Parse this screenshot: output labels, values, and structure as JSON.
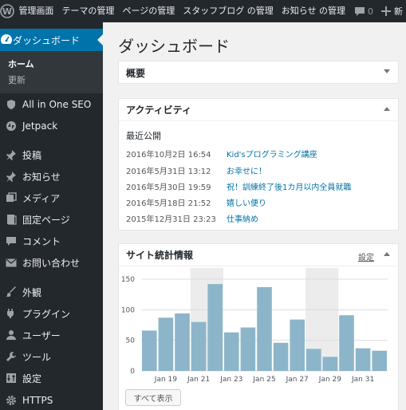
{
  "adminbar": {
    "items": [
      "管理画面",
      "テーマの管理",
      "ページの管理",
      "スタッフブログ の管理",
      "お知らせ の管理"
    ],
    "comment_count": "0",
    "new_label": "新"
  },
  "sidebar": {
    "dashboard_label": "ダッシュボード",
    "submenu": [
      "ホーム",
      "更新"
    ],
    "items": [
      {
        "label": "All in One SEO",
        "icon": "shield-icon"
      },
      {
        "label": "Jetpack",
        "icon": "jetpack-icon"
      },
      {
        "label": "投稿",
        "icon": "pin-icon"
      },
      {
        "label": "お知らせ",
        "icon": "pin-icon"
      },
      {
        "label": "メディア",
        "icon": "media-icon"
      },
      {
        "label": "固定ページ",
        "icon": "page-icon"
      },
      {
        "label": "コメント",
        "icon": "comment-icon"
      },
      {
        "label": "お問い合わせ",
        "icon": "mail-icon"
      },
      {
        "label": "外観",
        "icon": "brush-icon"
      },
      {
        "label": "プラグイン",
        "icon": "plugin-icon"
      },
      {
        "label": "ユーザー",
        "icon": "user-icon"
      },
      {
        "label": "ツール",
        "icon": "wrench-icon"
      },
      {
        "label": "設定",
        "icon": "settings-icon"
      },
      {
        "label": "HTTPS",
        "icon": "gear-icon"
      }
    ]
  },
  "main": {
    "title": "ダッシュボード",
    "overview": {
      "title": "概要"
    },
    "activity": {
      "title": "アクティビティ",
      "subtitle": "最近公開",
      "rows": [
        {
          "date": "2016年10月2日 16:54",
          "title": "Kid'sプログラミング講座"
        },
        {
          "date": "2016年5月31日 13:12",
          "title": "お幸せに！"
        },
        {
          "date": "2016年5月30日 19:59",
          "title": "祝！訓練終了後1カ月以内全員就職"
        },
        {
          "date": "2016年5月18日 21:52",
          "title": "嬉しい便り"
        },
        {
          "date": "2015年12月31日 23:23",
          "title": "仕事納め"
        }
      ]
    },
    "stats": {
      "title": "サイト統計情報",
      "config_label": "設定",
      "show_all_label": "すべて表示"
    }
  },
  "colors": {
    "accent": "#0073aa",
    "bar": "#8cb5c9",
    "weekend_band": "#ececec"
  },
  "chart_data": {
    "type": "bar",
    "categories": [
      "Jan 18",
      "Jan 19",
      "Jan 20",
      "Jan 21",
      "Jan 22",
      "Jan 23",
      "Jan 24",
      "Jan 25",
      "Jan 26",
      "Jan 27",
      "Jan 28",
      "Jan 29",
      "Jan 30",
      "Jan 31",
      "Feb 1"
    ],
    "tick_labels": [
      "Jan 19",
      "Jan 21",
      "Jan 23",
      "Jan 25",
      "Jan 27",
      "Jan 29",
      "Jan 31"
    ],
    "values": [
      66,
      87,
      94,
      80,
      142,
      63,
      71,
      137,
      46,
      84,
      36,
      23,
      91,
      37,
      33
    ],
    "weekend_bands": [
      [
        3,
        4
      ],
      [
        10,
        11
      ]
    ],
    "yticks": [
      0,
      50,
      100,
      150
    ],
    "ylim": [
      0,
      150
    ],
    "grid": true
  }
}
